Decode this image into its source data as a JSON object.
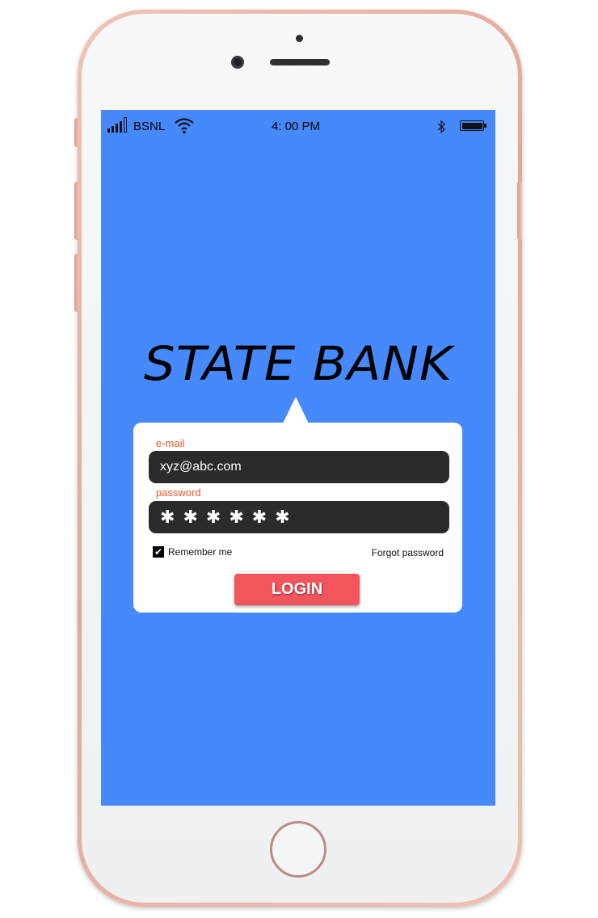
{
  "status_bar": {
    "carrier": "BSNL",
    "time": "4: 00 PM"
  },
  "brand": {
    "title": "STATE BANK"
  },
  "login_form": {
    "email_label": "e-mail",
    "email_value": "xyz@abc.com",
    "password_label": "password",
    "password_mask": [
      "✱",
      "✱",
      "✱",
      "✱",
      "✱",
      "✱"
    ],
    "remember_label": "Remember me",
    "remember_checked": true,
    "forgot_label": "Forgot password",
    "login_label": "LOGIN"
  },
  "colors": {
    "screen_bg": "#4689fd",
    "label_accent": "#f0532c",
    "field_bg": "#2b2b2b",
    "login_button": "#f4555c",
    "phone_frame": "#e8b0a0"
  },
  "icons": [
    "signal-icon",
    "wifi-icon",
    "bluetooth-icon",
    "battery-icon",
    "checkmark-icon"
  ]
}
